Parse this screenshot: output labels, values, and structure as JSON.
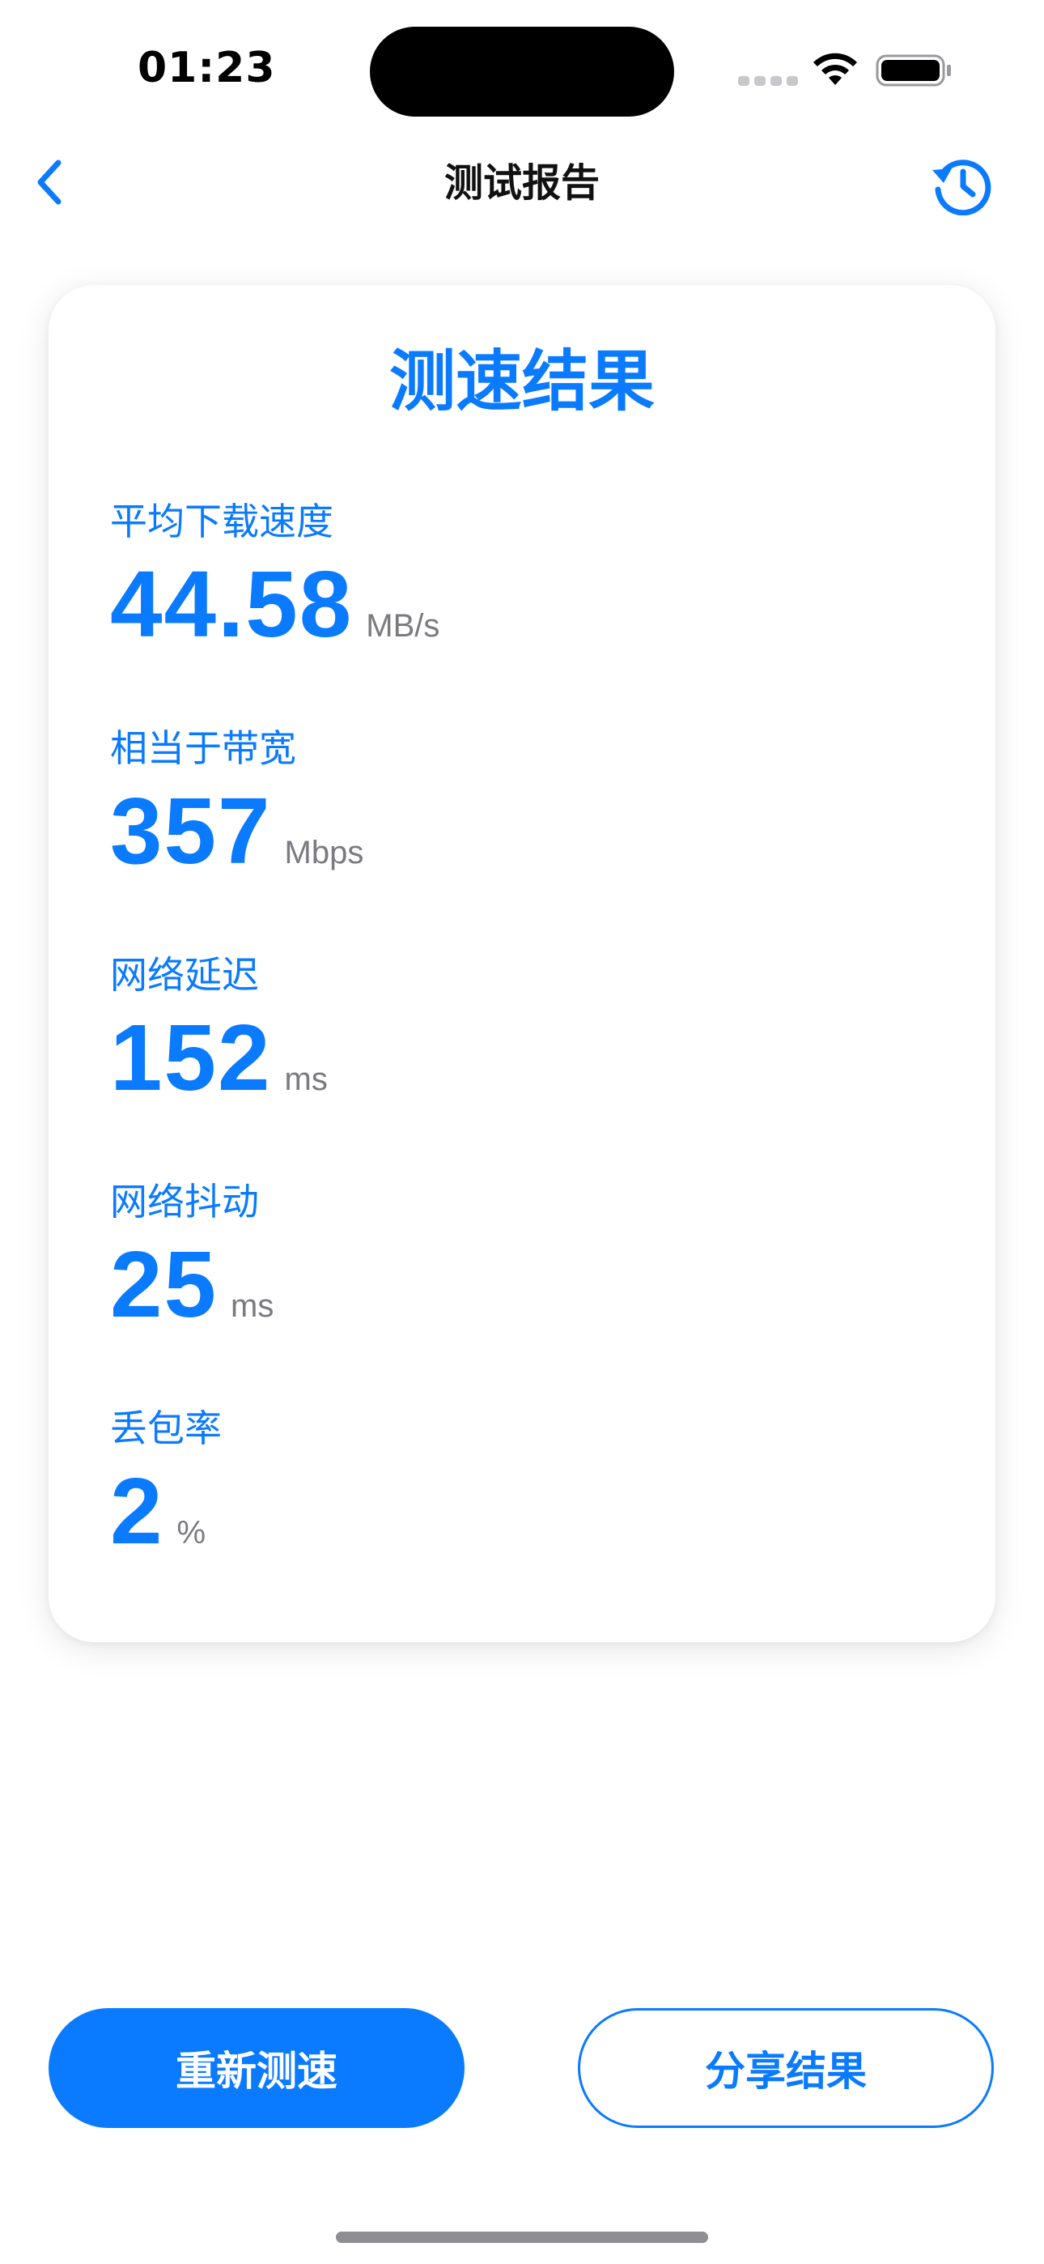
{
  "status_bar": {
    "time": "01:23"
  },
  "nav": {
    "title": "测试报告",
    "back_icon": "chevron-left-icon",
    "history_icon": "history-icon"
  },
  "card": {
    "title": "测速结果",
    "metrics": [
      {
        "label": "平均下载速度",
        "value": "44.58",
        "unit": "MB/s"
      },
      {
        "label": "相当于带宽",
        "value": "357",
        "unit": "Mbps"
      },
      {
        "label": "网络延迟",
        "value": "152",
        "unit": "ms"
      },
      {
        "label": "网络抖动",
        "value": "25",
        "unit": "ms"
      },
      {
        "label": "丢包率",
        "value": "2",
        "unit": "%"
      }
    ]
  },
  "actions": {
    "retest_label": "重新测速",
    "share_label": "分享结果"
  },
  "colors": {
    "accent": "#0a7aff",
    "unit_gray": "#7a7a80"
  }
}
